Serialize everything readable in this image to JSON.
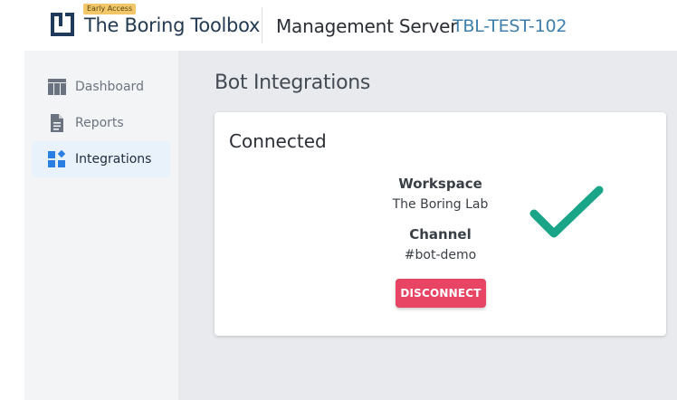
{
  "header": {
    "badge": "Early Access",
    "brand": "The Boring Toolbox",
    "server_title": "Management Server",
    "server_id": "TBL-TEST-102",
    "logo_icon": "toolbox-logo-icon"
  },
  "sidebar": {
    "items": [
      {
        "label": "Dashboard",
        "icon": "dashboard-icon",
        "active": false
      },
      {
        "label": "Reports",
        "icon": "document-icon",
        "active": false
      },
      {
        "label": "Integrations",
        "icon": "integrations-icon",
        "active": true
      }
    ]
  },
  "main": {
    "page_title": "Bot Integrations",
    "card": {
      "status": "Connected",
      "workspace_label": "Workspace",
      "workspace_value": "The Boring Lab",
      "channel_label": "Channel",
      "channel_value": "#bot-demo",
      "disconnect_label": "DISCONNECT",
      "status_icon": "checkmark-icon"
    }
  },
  "colors": {
    "accent_blue": "#3f7fae",
    "disconnect_red": "#e84565",
    "check_green": "#1aa589",
    "nav_active_bg": "#e9f1fb"
  }
}
